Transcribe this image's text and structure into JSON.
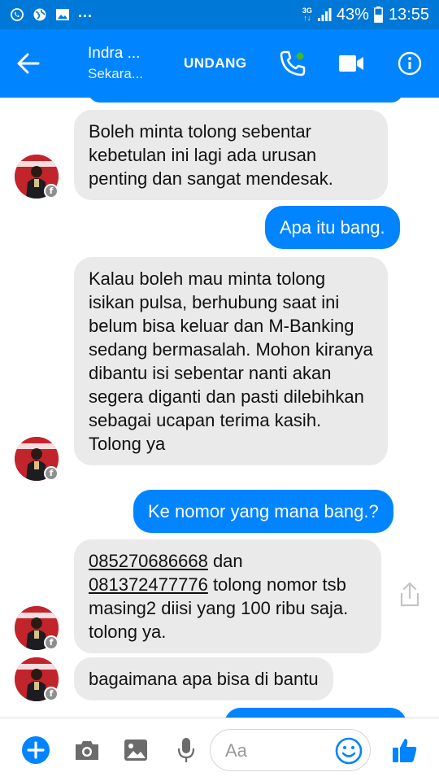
{
  "status_bar": {
    "network_top": "3G",
    "network_bottom": "↑↓",
    "more": "...",
    "battery": "43%",
    "time": "13:55"
  },
  "header": {
    "contact_name": "Indra ...",
    "contact_status": "Sekara...",
    "invite_label": "UNDANG",
    "icons": [
      "back-arrow-icon",
      "phone-icon",
      "video-camera-icon",
      "info-icon"
    ],
    "accent_color": "#0084ff",
    "online_color": "#42b72a"
  },
  "messages": [
    {
      "direction": "incoming",
      "text": "Boleh minta tolong sebentar kebetulan ini lagi ada urusan penting dan sangat mendesak."
    },
    {
      "direction": "outgoing",
      "text": "Apa itu bang."
    },
    {
      "direction": "incoming",
      "text": "Kalau boleh mau minta tolong isikan pulsa, berhubung saat ini belum bisa keluar dan M-Banking sedang bermasalah. Mohon kiranya dibantu isi sebentar nanti akan segera diganti dan pasti dilebihkan sebagai ucapan terima kasih. Tolong ya"
    },
    {
      "direction": "outgoing",
      "text": "Ke nomor yang mana bang.?"
    },
    {
      "direction": "incoming",
      "phone1": "085270686668",
      "mid": " dan ",
      "phone2": "081372477776",
      "rest": " tolong nomor tsb masing2 diisi yang 100 ribu saja. tolong ya."
    },
    {
      "direction": "incoming",
      "text": "bagaimana apa bisa di bantu"
    }
  ],
  "composer": {
    "placeholder": "Aa",
    "icons": [
      "plus-icon",
      "camera-icon",
      "image-icon",
      "microphone-icon",
      "emoji-icon",
      "thumbs-up-icon"
    ]
  },
  "colors": {
    "status_bar": "#0078d7",
    "outgoing_bubble": "#0084ff",
    "incoming_bubble": "#eaeaea"
  }
}
